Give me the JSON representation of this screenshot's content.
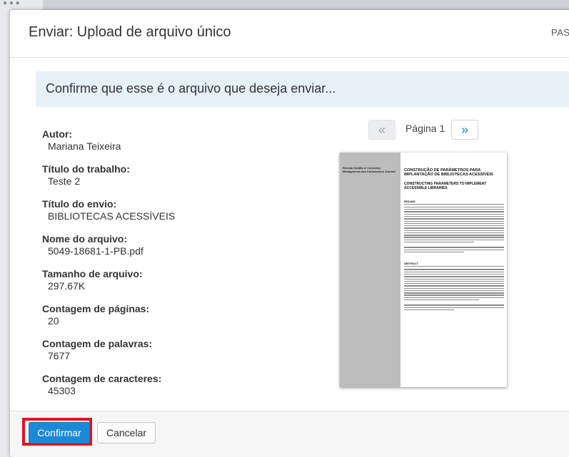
{
  "modal": {
    "title": "Enviar: Upload de arquivo único",
    "step_label": "PAS"
  },
  "confirm": {
    "message": "Confirme que esse é o arquivo que deseja enviar..."
  },
  "metadata": [
    {
      "label": "Autor:",
      "value": "Mariana Teixeira"
    },
    {
      "label": "Título do trabalho:",
      "value": "Teste 2"
    },
    {
      "label": "Título do envio:",
      "value": "BIBLIOTECAS ACESSÍVEIS"
    },
    {
      "label": "Nome do arquivo:",
      "value": "5049-18681-1-PB.pdf"
    },
    {
      "label": "Tamanho de arquivo:",
      "value": "297.67K"
    },
    {
      "label": "Contagem de páginas:",
      "value": "20"
    },
    {
      "label": "Contagem de palavras:",
      "value": "7677"
    },
    {
      "label": "Contagem de caracteres:",
      "value": "45303"
    }
  ],
  "pager": {
    "prev_icon": "«",
    "next_icon": "»",
    "label": "Página 1"
  },
  "preview": {
    "journal": "Revista Gestão & Conexões Management and Connections Journal",
    "title_pt": "CONSTRUÇÃO DE PARÂMETROS PARA IMPLANTAÇÃO DE BIBLIOTECAS ACESSÍVEIS",
    "title_en": "CONSTRUCTING PARAMETERS TO IMPLEMENT ACCESSIBLE LIBRARIES",
    "section_resumo": "RESUMO",
    "section_abstract": "ABSTRACT"
  },
  "footer": {
    "confirm_label": "Confirmar",
    "cancel_label": "Cancelar"
  },
  "colors": {
    "primary": "#1e88d8",
    "banner": "#e5f1f7",
    "highlight": "#e0141c"
  }
}
